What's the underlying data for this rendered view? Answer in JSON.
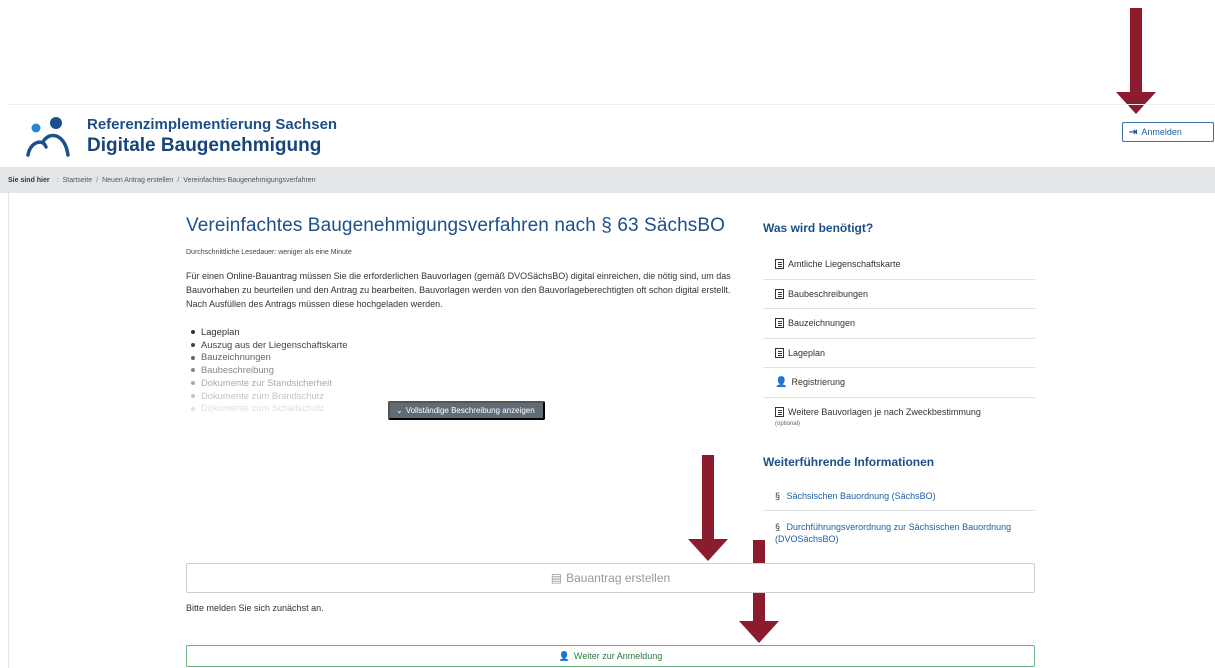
{
  "header": {
    "org_name": "Referenzimplementierung Sachsen",
    "app_name": "Digitale Baugenehmigung",
    "login_label": "Anmelden"
  },
  "breadcrumb": {
    "prefix": "Sie sind hier",
    "items": [
      "Startseite",
      "Neuen Antrag erstellen",
      "Vereinfachtes Baugenehmigungsverfahren"
    ]
  },
  "main": {
    "title": "Vereinfachtes Baugenehmigungsverfahren nach § 63 SächsBO",
    "reading_time": "Durchschnittliche Lesedauer: weniger als eine Minute",
    "intro": "Für einen Online-Bauantrag müssen Sie die erforderlichen Bauvorlagen (gemäß DVOSächsBO) digital einreichen, die nötig sind, um das Bauvorhaben zu beurteilen und den Antrag zu bearbeiten. Bauvorlagen werden von den Bauvorlageberechtigten oft schon digital erstellt. Nach Ausfüllen des Antrags müssen diese hochgeladen werden.",
    "documents": [
      "Lageplan",
      "Auszug aus der Liegenschaftskarte",
      "Bauzeichnungen",
      "Baubeschreibung",
      "Dokumente zur Standsicherheit",
      "Dokumente zum Brandschutz",
      "Dokumente zum Schallschutz"
    ],
    "show_more_label": "Vollständige Beschreibung anzeigen",
    "create_label": "Bauantrag erstellen",
    "login_hint": "Bitte melden Sie sich zunächst an.",
    "continue_label": "Weiter zur Anmeldung"
  },
  "sidebar": {
    "needed_title": "Was wird benötigt?",
    "needed_items": [
      {
        "label": "Amtliche Liegenschaftskarte",
        "icon": "document-icon"
      },
      {
        "label": "Baubeschreibungen",
        "icon": "document-icon"
      },
      {
        "label": "Bauzeichnungen",
        "icon": "document-icon"
      },
      {
        "label": "Lageplan",
        "icon": "document-icon"
      },
      {
        "label": "Registrierung",
        "icon": "user-icon"
      },
      {
        "label": "Weitere Bauvorlagen je nach Zweckbestimmung",
        "note": "(optional)",
        "icon": "document-icon"
      }
    ],
    "info_title": "Weiterführende Informationen",
    "info_links": [
      {
        "symbol": "§",
        "label": "Sächsischen Bauordnung (SächsBO)"
      },
      {
        "symbol": "§",
        "label": "Durchführungsverordnung zur Sächsischen Bauordnung (DVOSächsBO)"
      }
    ]
  },
  "colors": {
    "primary_blue": "#1d4f8a",
    "annotation_arrow": "#8b1c2e",
    "breadcrumb_bg": "#e3e6e9",
    "success_green": "#2a7a3e"
  }
}
